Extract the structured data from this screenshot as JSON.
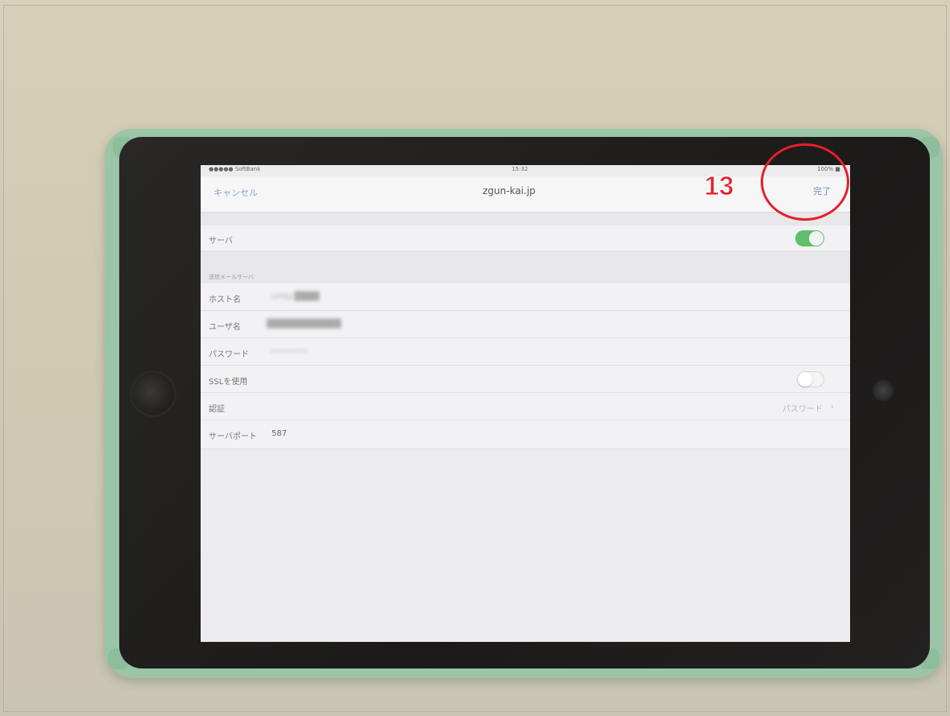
{
  "status_bar": {
    "carrier": "●●●●● SoftBank",
    "time": "15:32",
    "battery": "100% ■"
  },
  "nav": {
    "cancel_label": "キャンセル",
    "title": "zgun-kai.jp",
    "done_label": "完了"
  },
  "server_row": {
    "label": "サーバ",
    "toggle_on": true
  },
  "section_header": "送信メールサーバ",
  "fields": [
    {
      "label": "ホスト名",
      "value": "smtp.████"
    },
    {
      "label": "ユーザ名",
      "value": "████████████"
    },
    {
      "label": "パスワード",
      "value": "••••••••"
    }
  ],
  "ssl_row": {
    "label": "SSLを使用",
    "toggle_on": false
  },
  "auth_row": {
    "label": "認証",
    "value": "パスワード"
  },
  "port_row": {
    "label": "サーバポート",
    "value": "587"
  },
  "annotation": {
    "step": "13",
    "color": "#e5202a"
  },
  "colors": {
    "toggle_on": "#5fbf6d",
    "link_blue": "#6d8fc4",
    "case": "#9ac5a6"
  }
}
